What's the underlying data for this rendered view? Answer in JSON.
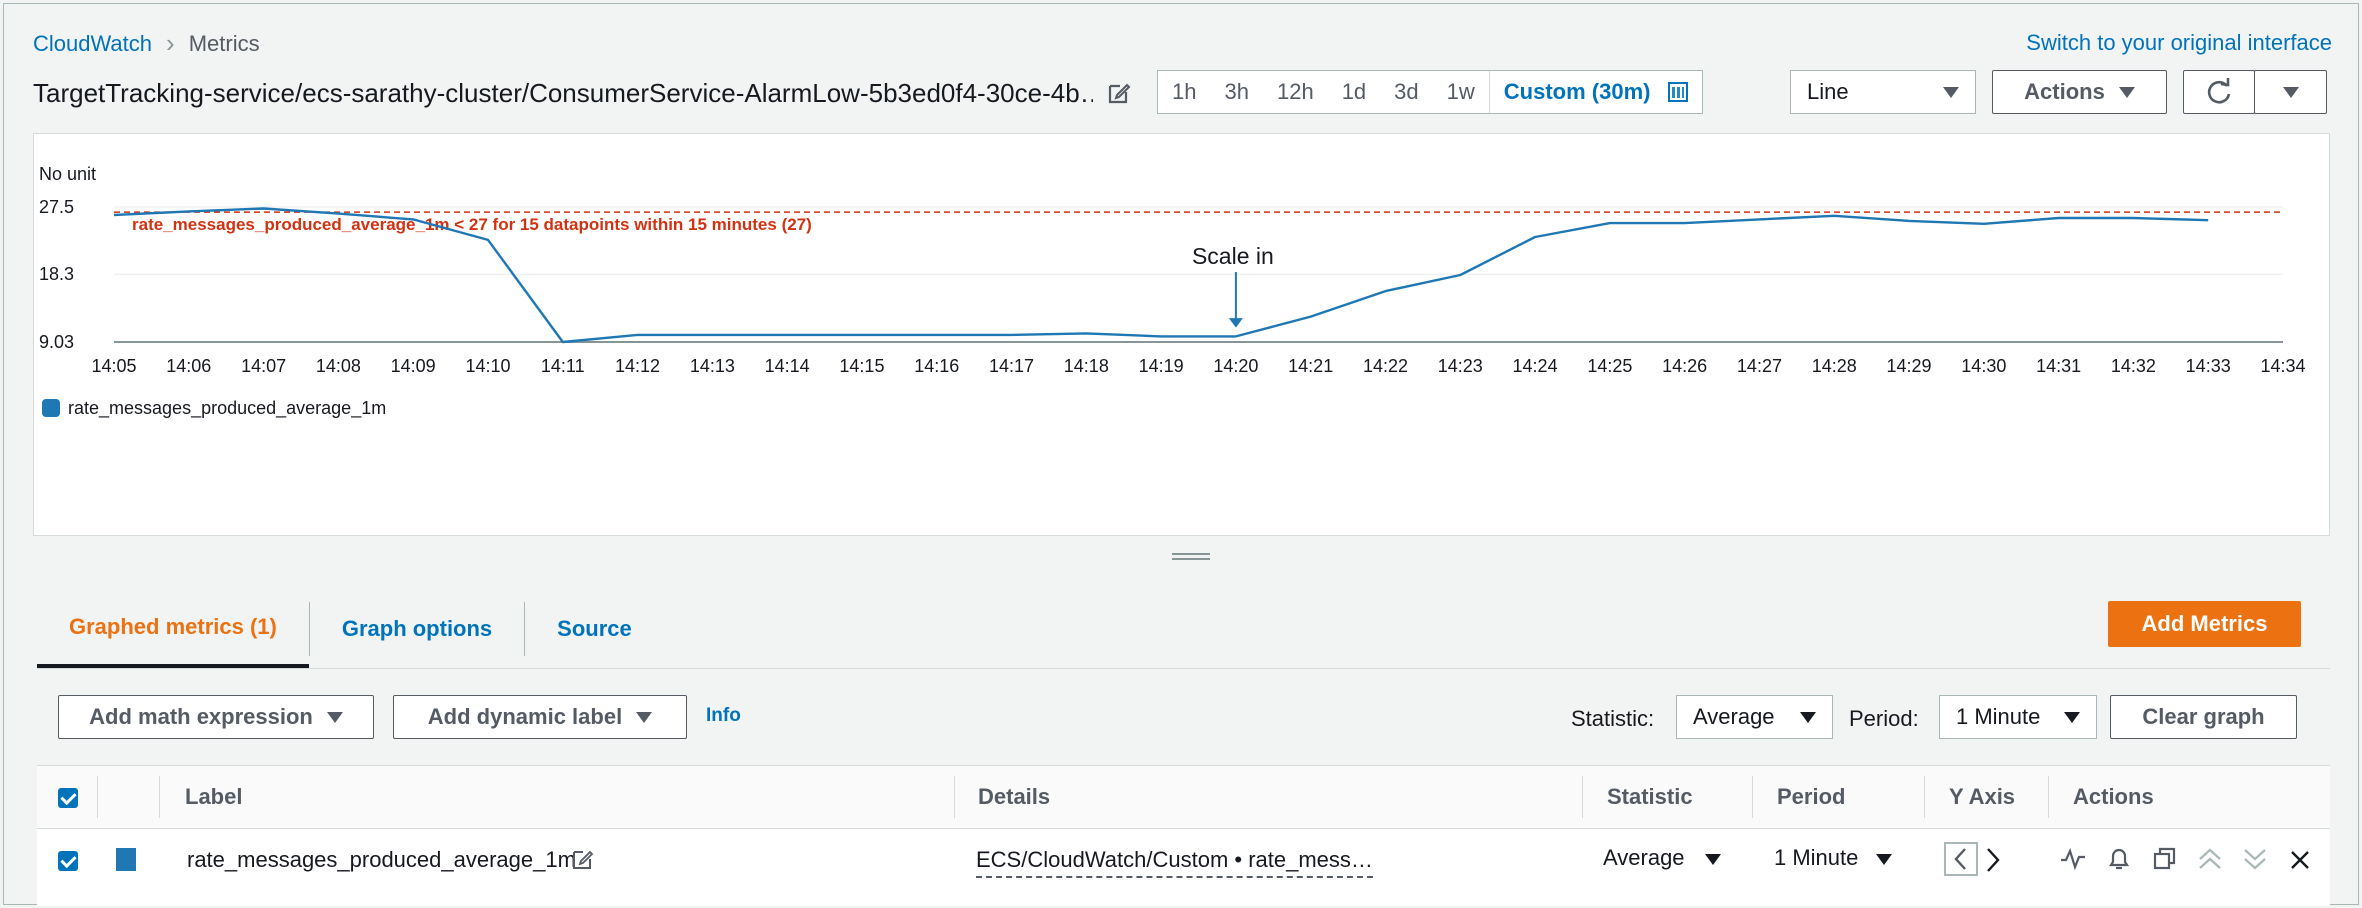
{
  "breadcrumb": {
    "root": "CloudWatch",
    "current": "Metrics"
  },
  "switch_link": "Switch to your original interface",
  "title": "TargetTracking-service/ecs-sarathy-cluster/ConsumerService-AlarmLow-5b3ed0f4-30ce-4b…",
  "time_ranges": [
    "1h",
    "3h",
    "12h",
    "1d",
    "3d",
    "1w"
  ],
  "custom_range": "Custom (30m)",
  "chart_type_select": "Line",
  "actions_label": "Actions",
  "tabs": [
    "Graphed metrics (1)",
    "Graph options",
    "Source"
  ],
  "add_metrics_label": "Add Metrics",
  "toolbar": {
    "add_math": "Add math expression",
    "add_dynamic": "Add dynamic label",
    "info": "Info",
    "statistic_label": "Statistic:",
    "statistic_value": "Average",
    "period_label": "Period:",
    "period_value": "1 Minute",
    "clear_graph": "Clear graph"
  },
  "table": {
    "headers": [
      "Label",
      "Details",
      "Statistic",
      "Period",
      "Y Axis",
      "Actions"
    ],
    "rows": [
      {
        "label": "rate_messages_produced_average_1m",
        "details": "ECS/CloudWatch/Custom • rate_mess…",
        "statistic": "Average",
        "period": "1 Minute"
      }
    ]
  },
  "colors": {
    "accent": "#0073bb",
    "orange": "#ec7211",
    "alarm": "#d13212",
    "series": "#1f77b4"
  },
  "chart_data": {
    "type": "line",
    "ylabel": "No unit",
    "yticks": [
      9.03,
      18.3,
      27.5
    ],
    "ylim": [
      9.03,
      27.5
    ],
    "x": [
      "14:05",
      "14:06",
      "14:07",
      "14:08",
      "14:09",
      "14:10",
      "14:11",
      "14:12",
      "14:13",
      "14:14",
      "14:15",
      "14:16",
      "14:17",
      "14:18",
      "14:19",
      "14:20",
      "14:21",
      "14:22",
      "14:23",
      "14:24",
      "14:25",
      "14:26",
      "14:27",
      "14:28",
      "14:29",
      "14:30",
      "14:31",
      "14:32",
      "14:33"
    ],
    "xticks": [
      "14:05",
      "14:06",
      "14:07",
      "14:08",
      "14:09",
      "14:10",
      "14:11",
      "14:12",
      "14:13",
      "14:14",
      "14:15",
      "14:16",
      "14:17",
      "14:18",
      "14:19",
      "14:20",
      "14:21",
      "14:22",
      "14:23",
      "14:24",
      "14:25",
      "14:26",
      "14:27",
      "14:28",
      "14:29",
      "14:30",
      "14:31",
      "14:32",
      "14:33",
      "14:34"
    ],
    "series": [
      {
        "name": "rate_messages_produced_average_1m",
        "values": [
          26.4,
          26.9,
          27.3,
          26.6,
          25.8,
          23.0,
          9.03,
          10.0,
          10.0,
          10.0,
          10.0,
          10.0,
          10.0,
          10.2,
          9.8,
          9.8,
          12.5,
          16.0,
          18.2,
          23.4,
          25.3,
          25.3,
          25.8,
          26.3,
          25.6,
          25.2,
          26.0,
          26.0,
          25.7
        ]
      }
    ],
    "threshold": {
      "value": 26.8,
      "label": "rate_messages_produced_average_1m < 27 for 15 datapoints within 15 minutes (27)"
    },
    "annotation": {
      "text": "Scale in",
      "x": "14:20"
    },
    "legend_position": "bottom-left"
  }
}
